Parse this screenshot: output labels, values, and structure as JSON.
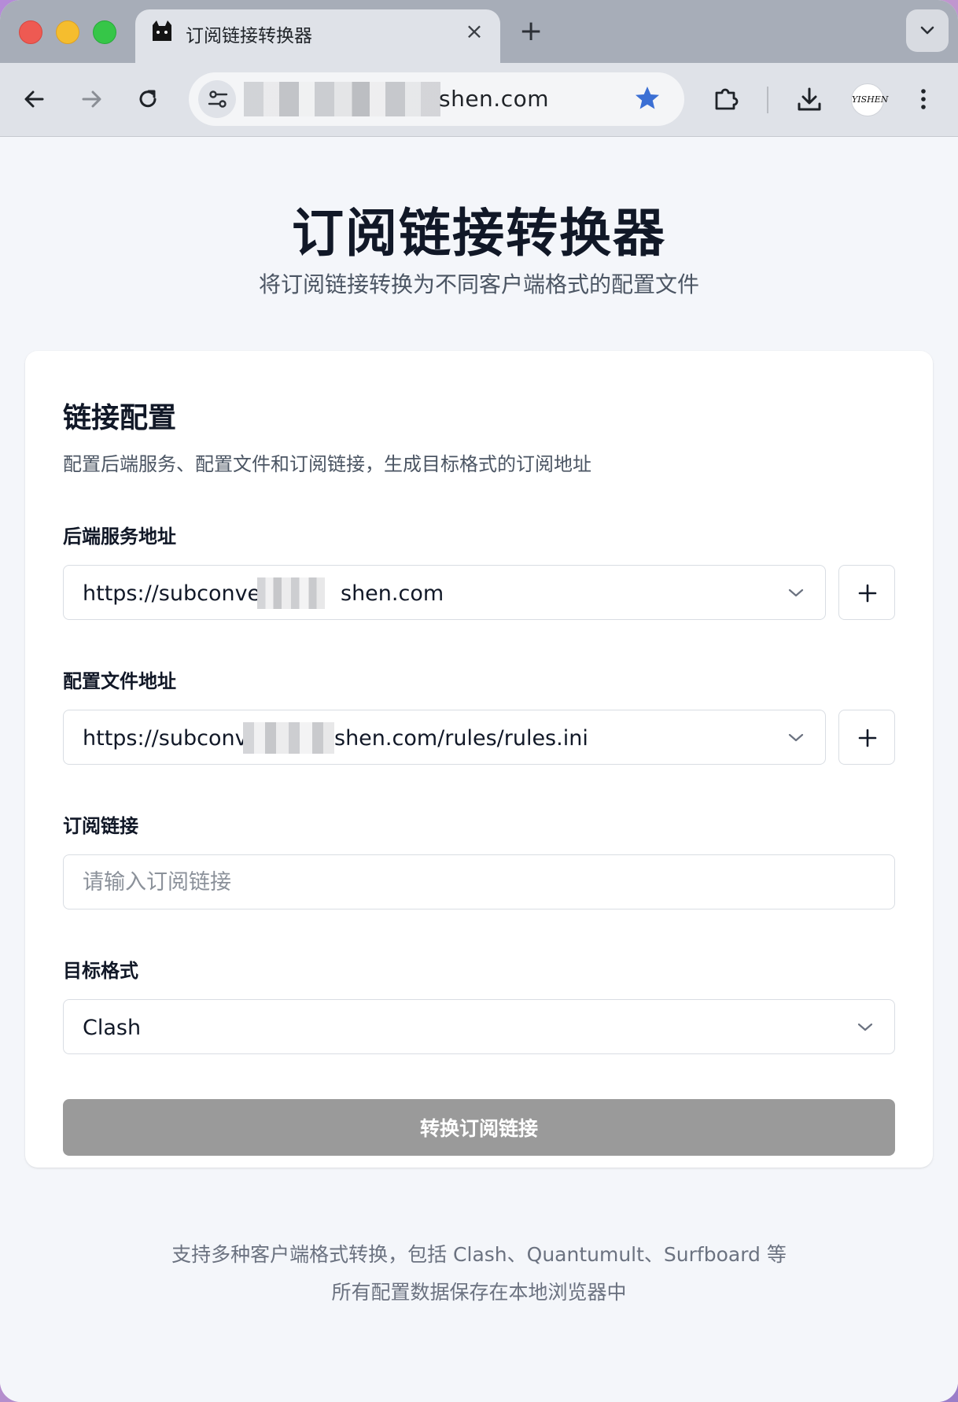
{
  "browser": {
    "tab_title": "订阅链接转换器",
    "tab_close": "×",
    "new_tab": "+",
    "url_visible": "shen.com",
    "avatar_text": "YISHEN"
  },
  "header": {
    "title": "订阅链接转换器",
    "subtitle": "将订阅链接转换为不同客户端格式的配置文件"
  },
  "card": {
    "title": "链接配置",
    "description": "配置后端服务、配置文件和订阅链接，生成目标格式的订阅地址",
    "backend": {
      "label": "后端服务地址",
      "value_prefix": "https://subconver",
      "value_suffix": "shen.com"
    },
    "config": {
      "label": "配置文件地址",
      "value_prefix": "https://subconv",
      "value_suffix": "shen.com/rules/rules.ini"
    },
    "subscription": {
      "label": "订阅链接",
      "placeholder": "请输入订阅链接",
      "value": ""
    },
    "target": {
      "label": "目标格式",
      "value": "Clash"
    },
    "submit_label": "转换订阅链接"
  },
  "footer": {
    "line1": "支持多种客户端格式转换，包括 Clash、Quantumult、Surfboard 等",
    "line2": "所有配置数据保存在本地浏览器中"
  },
  "colors": {
    "accent_star": "#3b6fd4",
    "button_disabled": "#9a9a9a",
    "page_bg": "#f4f6fa"
  }
}
